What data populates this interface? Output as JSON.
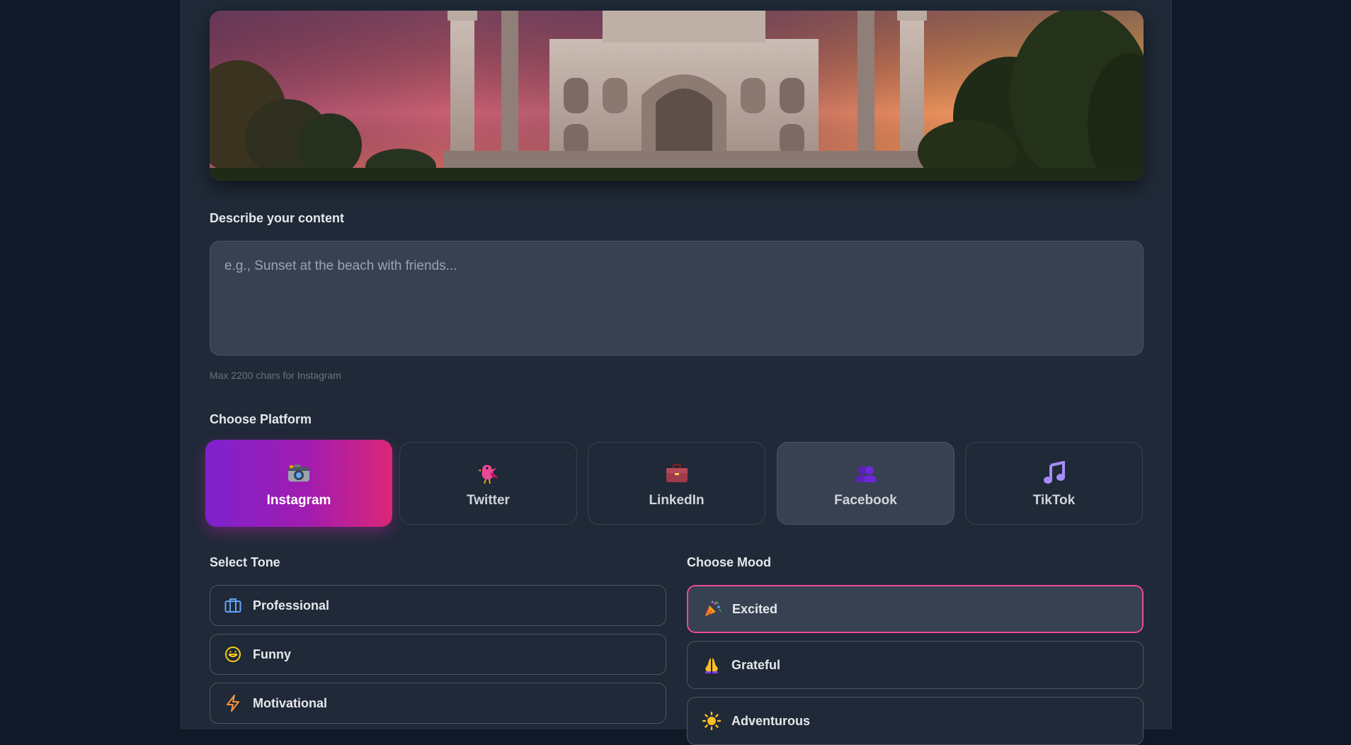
{
  "content": {
    "label": "Describe your content",
    "placeholder": "e.g., Sunset at the beach with friends...",
    "value": "",
    "hint": "Max 2200 chars for Instagram"
  },
  "platform": {
    "label": "Choose Platform",
    "selected": "Instagram",
    "items": [
      {
        "label": "Instagram",
        "icon": "camera-icon"
      },
      {
        "label": "Twitter",
        "icon": "bird-icon"
      },
      {
        "label": "LinkedIn",
        "icon": "briefcase-icon"
      },
      {
        "label": "Facebook",
        "icon": "people-icon"
      },
      {
        "label": "TikTok",
        "icon": "music-note-icon"
      }
    ]
  },
  "tone": {
    "label": "Select Tone",
    "items": [
      {
        "label": "Professional",
        "icon": "briefcase-outline-icon"
      },
      {
        "label": "Funny",
        "icon": "smile-icon"
      },
      {
        "label": "Motivational",
        "icon": "lightning-icon"
      }
    ]
  },
  "mood": {
    "label": "Choose Mood",
    "selected": "Excited",
    "items": [
      {
        "label": "Excited",
        "icon": "party-popper-icon"
      },
      {
        "label": "Grateful",
        "icon": "praying-hands-icon"
      },
      {
        "label": "Adventurous",
        "icon": "sun-icon"
      }
    ]
  },
  "colors": {
    "accent_gradient_start": "#7e22ce",
    "accent_gradient_end": "#db2777",
    "selected_border": "#ec4899",
    "panel": "#1f2937",
    "background": "#111827"
  }
}
